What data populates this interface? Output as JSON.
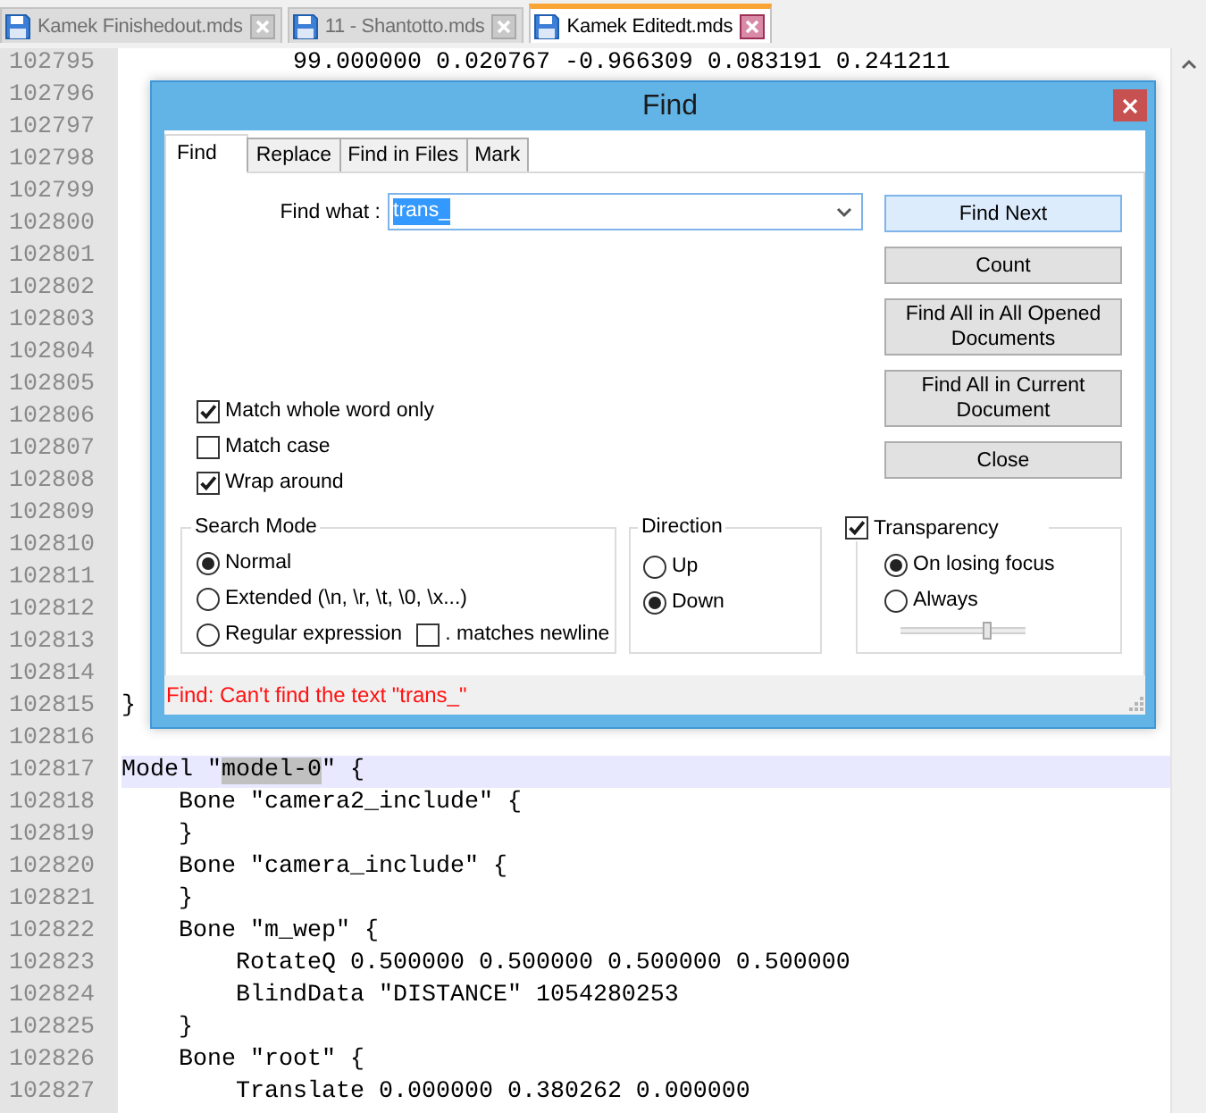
{
  "tabs": [
    {
      "label": "Kamek Finishedout.mds",
      "selected": false
    },
    {
      "label": "11 - Shantotto.mds",
      "selected": false
    },
    {
      "label": "Kamek Editedt.mds",
      "selected": true
    }
  ],
  "editor": {
    "lines": [
      {
        "number": "102795",
        "text": "            99.000000 0.020767 -0.966309 0.083191 0.241211",
        "current": false
      },
      {
        "number": "102796"
      },
      {
        "number": "102797"
      },
      {
        "number": "102798"
      },
      {
        "number": "102799"
      },
      {
        "number": "102800"
      },
      {
        "number": "102801"
      },
      {
        "number": "102802"
      },
      {
        "number": "102803"
      },
      {
        "number": "102804"
      },
      {
        "number": "102805"
      },
      {
        "number": "102806"
      },
      {
        "number": "102807"
      },
      {
        "number": "102808"
      },
      {
        "number": "102809"
      },
      {
        "number": "102810"
      },
      {
        "number": "102811"
      },
      {
        "number": "102812"
      },
      {
        "number": "102813"
      },
      {
        "number": "102814"
      },
      {
        "number": "102815",
        "text": "}",
        "current": false
      },
      {
        "number": "102816"
      },
      {
        "number": "102817",
        "segments": [
          {
            "text": "Model \"",
            "selected": false
          },
          {
            "text": "model-0",
            "selected": true
          },
          {
            "text": "\" {",
            "selected": false
          }
        ],
        "current": true
      },
      {
        "number": "102818",
        "text": "    Bone \"camera2_include\" {",
        "current": false
      },
      {
        "number": "102819",
        "text": "    }",
        "current": false
      },
      {
        "number": "102820",
        "text": "    Bone \"camera_include\" {",
        "current": false
      },
      {
        "number": "102821",
        "text": "    }",
        "current": false
      },
      {
        "number": "102822",
        "text": "    Bone \"m_wep\" {",
        "current": false
      },
      {
        "number": "102823",
        "text": "        RotateQ 0.500000 0.500000 0.500000 0.500000",
        "current": false
      },
      {
        "number": "102824",
        "text": "        BlindData \"DISTANCE\" 1054280253",
        "current": false
      },
      {
        "number": "102825",
        "text": "    }",
        "current": false
      },
      {
        "number": "102826",
        "text": "    Bone \"root\" {",
        "current": false
      },
      {
        "number": "102827",
        "text": "        Translate 0.000000 0.380262 0.000000",
        "current": false
      }
    ]
  },
  "find_dialog": {
    "title": "Find",
    "tabs": [
      {
        "label": "Find",
        "selected": true
      },
      {
        "label": "Replace",
        "selected": false
      },
      {
        "label": "Find in Files",
        "selected": false
      },
      {
        "label": "Mark",
        "selected": false
      }
    ],
    "find_what": {
      "label": "Find what :",
      "value": "trans_",
      "text_selected": true
    },
    "buttons": [
      {
        "label": "Find Next",
        "default": true
      },
      {
        "label": "Count",
        "default": false
      },
      {
        "label": "Find All in All Opened Documents",
        "default": false
      },
      {
        "label": "Find All in Current Document",
        "default": false
      },
      {
        "label": "Close",
        "default": false
      }
    ],
    "options": [
      {
        "label": "Match whole word only",
        "checked": true
      },
      {
        "label": "Match case",
        "checked": false
      },
      {
        "label": "Wrap around",
        "checked": true
      }
    ],
    "search_mode": {
      "title": "Search Mode",
      "modes": [
        {
          "label": "Normal",
          "selected": true
        },
        {
          "label": "Extended (\\n, \\r, \\t, \\0, \\x...)",
          "selected": false
        },
        {
          "label": "Regular expression",
          "selected": false
        }
      ],
      "matches_newline": {
        "label": ". matches newline",
        "checked": false
      }
    },
    "direction": {
      "title": "Direction",
      "options": [
        {
          "label": "Up",
          "selected": false
        },
        {
          "label": "Down",
          "selected": true
        }
      ]
    },
    "transparency": {
      "label": "Transparency",
      "checked": true,
      "options": [
        {
          "label": "On losing focus",
          "selected": true
        },
        {
          "label": "Always",
          "selected": false
        }
      ],
      "level": 0.7
    },
    "status_message": "Find: Can't find the text \"trans_\""
  }
}
